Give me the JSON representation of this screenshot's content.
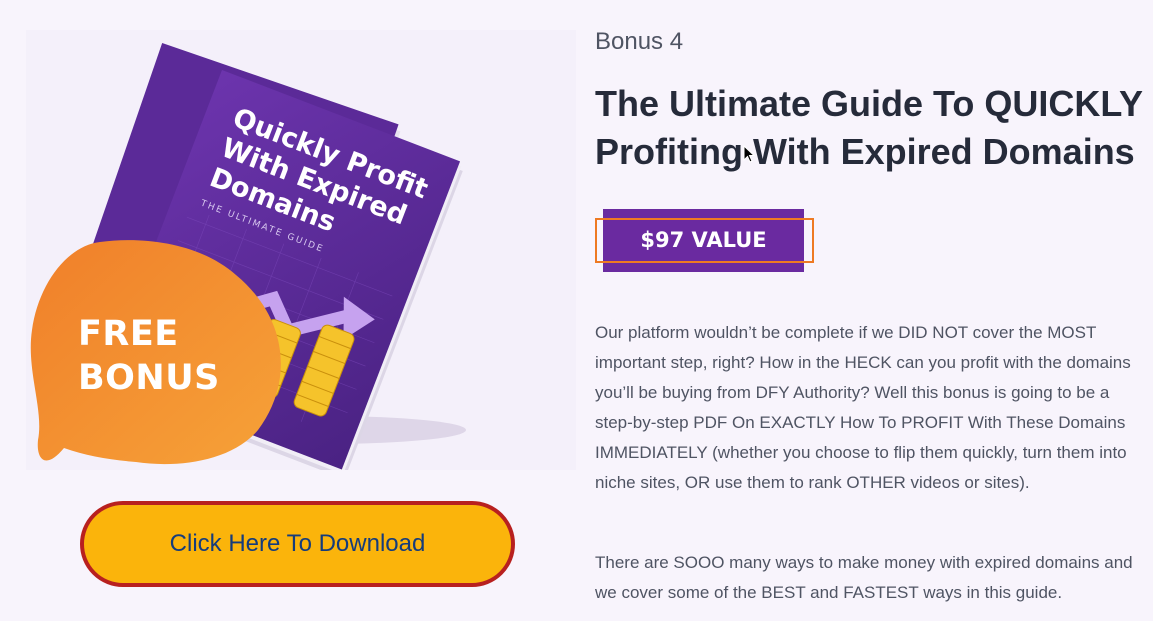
{
  "promo": {
    "book_title_lines": [
      "Quickly Profit",
      "With Expired",
      "Domains"
    ],
    "book_subtitle": "THE ULTIMATE GUIDE",
    "badge_line1": "FREE",
    "badge_line2": "BONUS"
  },
  "download_button": {
    "label": "Click Here To Download"
  },
  "bonus": {
    "label": "Bonus 4",
    "title": "The Ultimate Guide To QUICKLY Profiting With Expired Domains",
    "value": "$97 VALUE",
    "paragraphs": [
      "Our platform wouldn’t be complete if we DID NOT cover the MOST important step, right? How in the HECK can you profit with the domains you’ll be buying from DFY Authority? Well this bonus is going to be a step-by-step PDF On EXACTLY How To PROFIT With These Domains IMMEDIATELY (whether you choose to flip them quickly, turn them into niche sites, OR use them to rank OTHER videos or sites).",
      "There are SOOO many ways to make money with expired domains and we cover some of the BEST and FASTEST ways in this guide."
    ]
  },
  "colors": {
    "background": "#f8f4fc",
    "book_purple": "#5a2a96",
    "badge_orange": "#f28a2e",
    "value_badge": "#6a2aa0",
    "value_frame": "#ee7a23",
    "button_fill": "#fbb40b",
    "button_border": "#b8201f",
    "button_text": "#153c7c",
    "title_text": "#262b3a",
    "body_text": "#4f5463"
  }
}
